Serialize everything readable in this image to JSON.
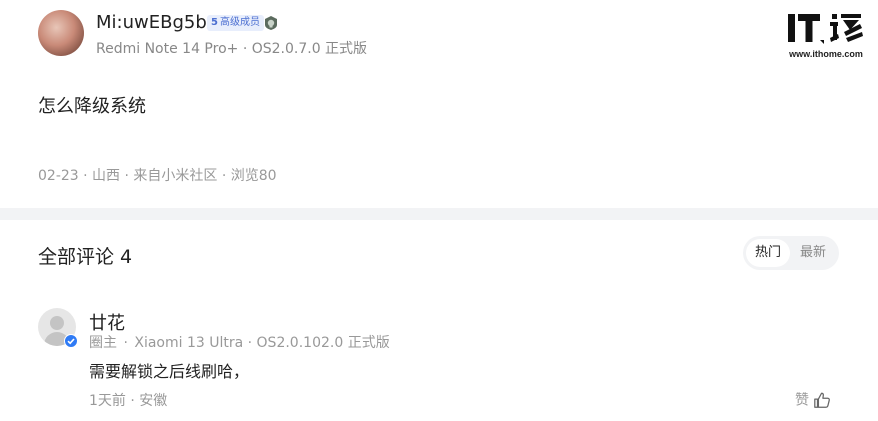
{
  "post": {
    "author": {
      "name": "Mi:uwEBg5b",
      "level_number": "5",
      "level_label": "高级成员",
      "device": "Redmi Note 14 Pro+ · OS2.0.7.0 正式版"
    },
    "body": "怎么降级系统",
    "meta": "02-23 · 山西 · 来自小米社区 · 浏览80"
  },
  "watermark": {
    "url": "www.ithome.com"
  },
  "comments": {
    "title": "全部评论 4",
    "sort": {
      "hot_label": "热门",
      "new_label": "最新",
      "selected": "热门"
    },
    "items": [
      {
        "name": "廿花",
        "role": "圈主",
        "device": "Xiaomi 13 Ultra · OS2.0.102.0 正式版",
        "text": "需要解锁之后线刷哈，",
        "meta": "1天前 · 安徽",
        "like_label": "赞"
      }
    ]
  },
  "colors": {
    "badge_bg": "#e8eefc",
    "badge_text": "#4c6fd1",
    "divider": "#f2f3f5",
    "verified": "#2f7bf5"
  }
}
